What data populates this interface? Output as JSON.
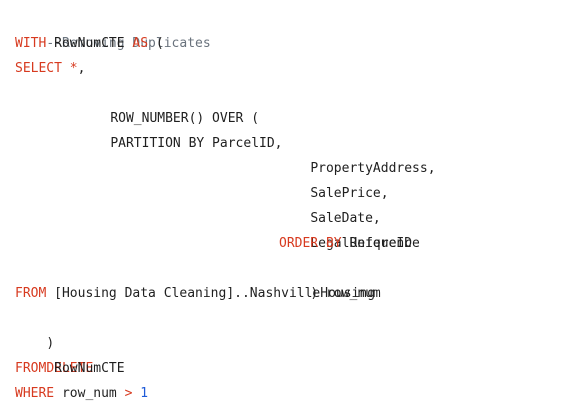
{
  "code": {
    "comment": "--Removing Duplicates",
    "line2": {
      "kw_with": "WITH",
      "name": " RowNumCTE ",
      "kw_as": "AS",
      "paren": " ("
    },
    "line3": {
      "kw_select": "SELECT",
      "star": " *",
      "comma": ","
    },
    "line4": {
      "text": "ROW_NUMBER() OVER ("
    },
    "line5": {
      "text": "PARTITION BY ParcelID,"
    },
    "line6": {
      "text": "PropertyAddress,"
    },
    "line7": {
      "text": "SalePrice,"
    },
    "line8": {
      "text": "SaleDate,"
    },
    "line9": {
      "text": "LegalReference"
    },
    "line10": {
      "kw_order": "ORDER BY",
      "text": " UniqueID"
    },
    "line11": {
      "text": ") row_num"
    },
    "line12": {
      "kw_from": "FROM",
      "text": " [Housing Data Cleaning]..NashvilleHousing"
    },
    "line13": {
      "text": ")"
    },
    "line14": {
      "kw_delete": "DELETE"
    },
    "line15": {
      "kw_from": "FROM",
      "text": " RowNumCTE"
    },
    "line16": {
      "kw_where": "WHERE",
      "text": " row_num ",
      "op": ">",
      "num": " 1"
    }
  },
  "colors": {
    "keyword": "#d73a1f",
    "comment": "#6a737d",
    "number": "#1f5bd8",
    "text": "#1f1f1f",
    "background": "#ffffff"
  }
}
